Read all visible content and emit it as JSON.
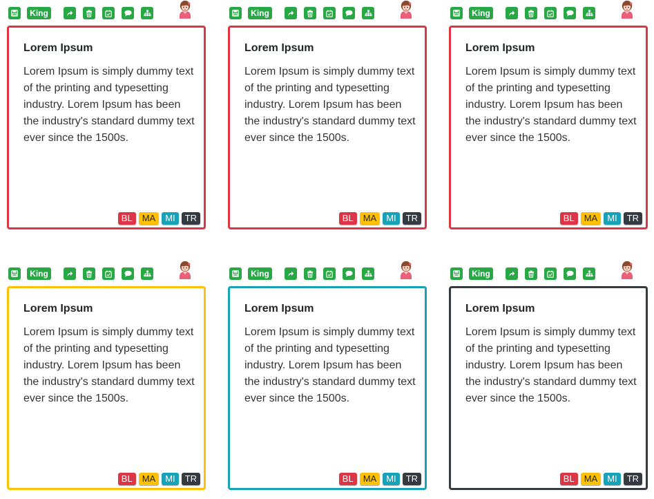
{
  "toolbar": {
    "user_label": "King",
    "icons": [
      "save-icon",
      "share-icon",
      "trash-icon",
      "calendar-check-icon",
      "chat-icon",
      "org-chart-icon",
      "avatar-icon"
    ],
    "accent": "#28a745"
  },
  "tags": [
    {
      "label": "BL",
      "color": "#dc3545"
    },
    {
      "label": "MA",
      "color": "#ffc107"
    },
    {
      "label": "MI",
      "color": "#17a2b8"
    },
    {
      "label": "TR",
      "color": "#343a40"
    }
  ],
  "cards": [
    {
      "title": "Lorem Ipsum",
      "text": "Lorem Ipsum is simply dummy text of the printing and typesetting industry. Lorem Ipsum has been the industry's standard dummy text ever since the 1500s.",
      "border_color": "#dc3545"
    },
    {
      "title": "Lorem Ipsum",
      "text": "Lorem Ipsum is simply dummy text of the printing and typesetting industry. Lorem Ipsum has been the industry's standard dummy text ever since the 1500s.",
      "border_color": "#dc3545"
    },
    {
      "title": "Lorem Ipsum",
      "text": "Lorem Ipsum is simply dummy text of the printing and typesetting industry. Lorem Ipsum has been the industry's standard dummy text ever since the 1500s.",
      "border_color": "#dc3545"
    },
    {
      "title": "Lorem Ipsum",
      "text": "Lorem Ipsum is simply dummy text of the printing and typesetting industry. Lorem Ipsum has been the industry's standard dummy text ever since the 1500s.",
      "border_color": "#ffc107"
    },
    {
      "title": "Lorem Ipsum",
      "text": "Lorem Ipsum is simply dummy text of the printing and typesetting industry. Lorem Ipsum has been the industry's standard dummy text ever since the 1500s.",
      "border_color": "#17a2b8"
    },
    {
      "title": "Lorem Ipsum",
      "text": "Lorem Ipsum is simply dummy text of the printing and typesetting industry. Lorem Ipsum has been the industry's standard dummy text ever since the 1500s.",
      "border_color": "#343a40"
    }
  ]
}
